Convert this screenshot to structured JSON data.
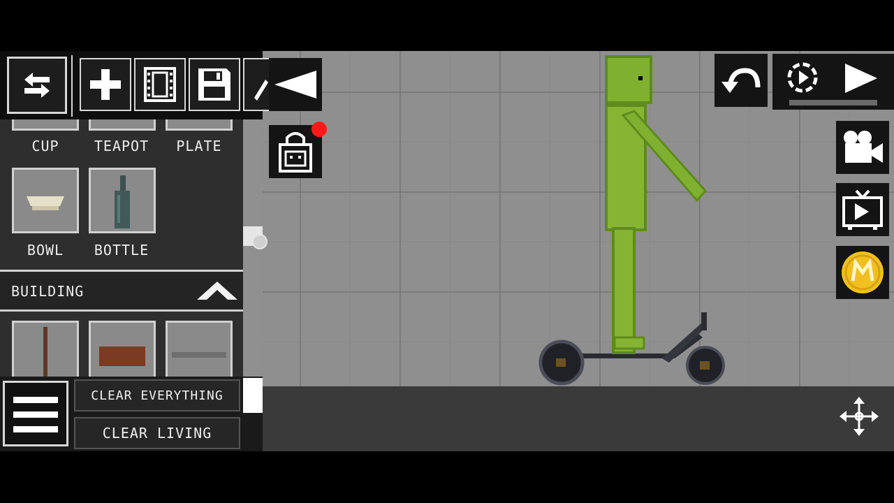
{
  "toolbar": {
    "swap_icon": "swap-arrows-icon",
    "add_icon": "plus-icon",
    "film_icon": "film-strip-icon",
    "save_icon": "floppy-save-icon"
  },
  "items_top": [
    {
      "label": "CUP"
    },
    {
      "label": "TEAPOT"
    },
    {
      "label": "PLATE"
    }
  ],
  "items_mid": [
    {
      "label": "BOWL"
    },
    {
      "label": "BOTTLE"
    }
  ],
  "section": {
    "title": "BUILDING"
  },
  "buttons": {
    "clear_everything": "CLEAR EVERYTHING",
    "clear_living": "CLEAR LIVING"
  },
  "colors": {
    "melon_green": "#8bc34a",
    "notification_red": "#ff1a1a",
    "coin_gold": "#f0c020"
  }
}
